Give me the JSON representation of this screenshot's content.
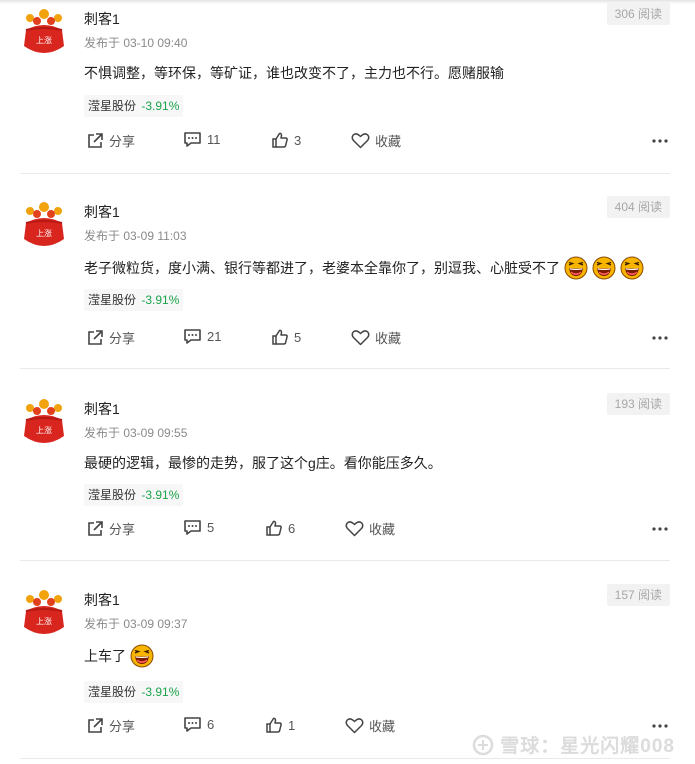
{
  "posts": [
    {
      "author": "刺客1",
      "avatar_badge": "上涨",
      "time": "发布于 03-10 09:40",
      "views": "306 阅读",
      "content": "不惧调整，等环保，等矿证，谁也改变不了，主力也不行。愿赌服输",
      "emojis": [],
      "stock_name": "滢星股份",
      "stock_change": "-3.91%",
      "share_label": "分享",
      "comments": "11",
      "likes": "3",
      "fav_label": "收藏"
    },
    {
      "author": "刺客1",
      "avatar_badge": "上涨",
      "time": "发布于 03-09 11:03",
      "views": "404 阅读",
      "content": "老子微粒货，度小满、银行等都进了，老婆本全靠你了，别逗我、心脏受不了",
      "emojis": [
        "laughing-emoji",
        "laughing-emoji",
        "laughing-emoji"
      ],
      "stock_name": "滢星股份",
      "stock_change": "-3.91%",
      "share_label": "分享",
      "comments": "21",
      "likes": "5",
      "fav_label": "收藏"
    },
    {
      "author": "刺客1",
      "avatar_badge": "上涨",
      "time": "发布于 03-09 09:55",
      "views": "193 阅读",
      "content": "最硬的逻辑，最惨的走势，服了这个g庄。看你能压多久。",
      "emojis": [],
      "stock_name": "滢星股份",
      "stock_change": "-3.91%",
      "share_label": "分享",
      "comments": "5",
      "likes": "6",
      "fav_label": "收藏"
    },
    {
      "author": "刺客1",
      "avatar_badge": "上涨",
      "time": "发布于 03-09 09:37",
      "views": "157 阅读",
      "content": "上车了",
      "emojis": [
        "laughing-emoji"
      ],
      "stock_name": "滢星股份",
      "stock_change": "-3.91%",
      "share_label": "分享",
      "comments": "6",
      "likes": "1",
      "fav_label": "收藏"
    }
  ],
  "watermark": "雪球：星光闪耀008",
  "colors": {
    "stock_down": "#1aa34a",
    "avatar_red": "#d8261f",
    "emoji_yellow": "#f7b500"
  }
}
